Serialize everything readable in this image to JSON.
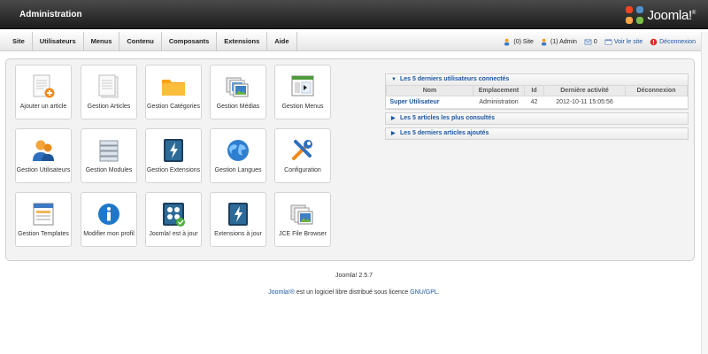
{
  "header": {
    "title": "Administration",
    "logo_text": "Joomla!",
    "logo_sup": "®"
  },
  "menu": [
    {
      "label": "Site"
    },
    {
      "label": "Utilisateurs"
    },
    {
      "label": "Menus"
    },
    {
      "label": "Contenu"
    },
    {
      "label": "Composants"
    },
    {
      "label": "Extensions"
    },
    {
      "label": "Aide"
    }
  ],
  "status": {
    "visitors": "(0) Site",
    "admins": "(1) Admin",
    "messages": "0",
    "view_site": "Voir le site",
    "logout": "Déconnexion"
  },
  "quickicons": [
    {
      "label": "Ajouter un article",
      "icon": "add-article-icon"
    },
    {
      "label": "Gestion Articles",
      "icon": "articles-icon"
    },
    {
      "label": "Gestion Catégories",
      "icon": "folder-icon"
    },
    {
      "label": "Gestion Médias",
      "icon": "media-icon"
    },
    {
      "label": "Gestion Menus",
      "icon": "menus-icon"
    },
    {
      "label": "Gestion Utilisateurs",
      "icon": "users-icon"
    },
    {
      "label": "Gestion Modules",
      "icon": "modules-icon"
    },
    {
      "label": "Gestion Extensions",
      "icon": "extensions-icon"
    },
    {
      "label": "Gestion Langues",
      "icon": "globe-icon"
    },
    {
      "label": "Configuration",
      "icon": "tools-icon"
    },
    {
      "label": "Gestion Templates",
      "icon": "templates-icon"
    },
    {
      "label": "Modifier mon profil",
      "icon": "info-icon"
    },
    {
      "label": "Joomla! est à jour",
      "icon": "joomla-update-icon"
    },
    {
      "label": "Extensions à jour",
      "icon": "extensions-update-icon"
    },
    {
      "label": "JCE File Browser",
      "icon": "file-browser-icon"
    }
  ],
  "modules": {
    "logged": {
      "title": "Les 5 derniers utilisateurs connectés",
      "columns": [
        "Nom",
        "Emplacement",
        "Id",
        "Dernière activité",
        "Déconnexion"
      ],
      "rows": [
        {
          "name": "Super Utilisateur",
          "location": "Administration",
          "id": "42",
          "activity": "2012-10-11 15:05:56",
          "logout": ""
        }
      ]
    },
    "popular": {
      "title": "Les 5 articles les plus consultés"
    },
    "latest": {
      "title": "Les 5 derniers articles ajoutés"
    }
  },
  "footer": {
    "version": "Joomla! 2.5.7",
    "license_link": "Joomla!®",
    "license_text": " est un logiciel libre distribué sous licence ",
    "license_name": "GNU/GPL",
    "license_end": "."
  }
}
